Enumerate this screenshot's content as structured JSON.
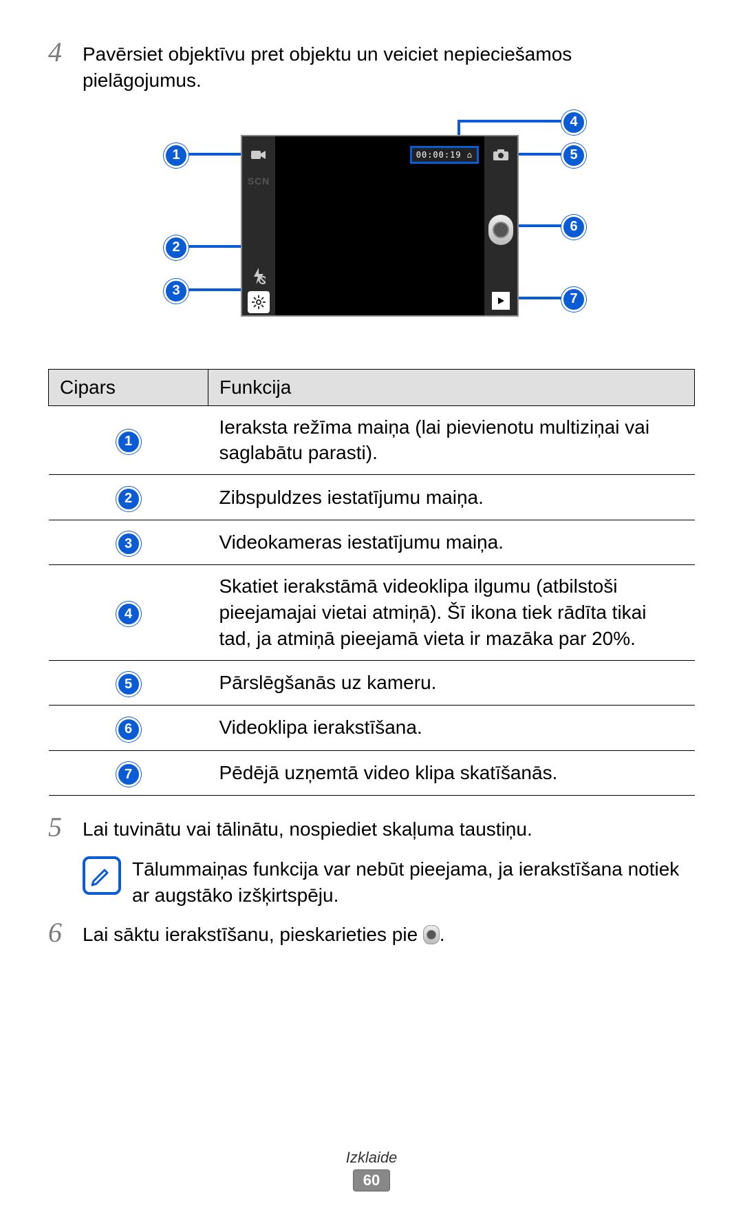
{
  "steps": {
    "four": {
      "num": "4",
      "text": "Pavērsiet objektīvu pret objektu un veiciet nepieciešamos pielāgojumus."
    },
    "five": {
      "num": "5",
      "text": "Lai tuvinātu vai tālinātu, nospiediet skaļuma taustiņu."
    },
    "six": {
      "num": "6",
      "text_before": "Lai sāktu ierakstīšanu, pieskarieties pie ",
      "text_after": "."
    }
  },
  "diagram": {
    "callouts": {
      "c1": "1",
      "c2": "2",
      "c3": "3",
      "c4": "4",
      "c5": "5",
      "c6": "6",
      "c7": "7"
    },
    "timer": "00:00:19 ⌂",
    "icons": {
      "video_mode": "video-mode-icon",
      "scn": "SCN",
      "flash": "flash-icon",
      "gear": "gear-icon",
      "camera_switch": "camera-switch-icon",
      "shutter": "shutter-icon",
      "play": "play-icon"
    }
  },
  "table": {
    "headers": {
      "num": "Cipars",
      "func": "Funkcija"
    },
    "rows": [
      {
        "n": "1",
        "desc": "Ieraksta režīma maiņa (lai pievienotu multiziņai vai saglabātu parasti)."
      },
      {
        "n": "2",
        "desc": "Zibspuldzes iestatījumu maiņa."
      },
      {
        "n": "3",
        "desc": "Videokameras iestatījumu maiņa."
      },
      {
        "n": "4",
        "desc": "Skatiet ierakstāmā videoklipa ilgumu (atbilstoši pieejamajai vietai atmiņā). Šī ikona tiek rādīta tikai tad, ja atmiņā pieejamā vieta ir mazāka par 20%."
      },
      {
        "n": "5",
        "desc": "Pārslēgšanās uz kameru."
      },
      {
        "n": "6",
        "desc": "Videoklipa ierakstīšana."
      },
      {
        "n": "7",
        "desc": "Pēdējā uzņemtā video klipa skatīšanās."
      }
    ]
  },
  "note": {
    "text": "Tālummaiņas funkcija var nebūt pieejama, ja ierakstīšana notiek ar augstāko izšķirtspēju."
  },
  "footer": {
    "section": "Izklaide",
    "page": "60"
  }
}
